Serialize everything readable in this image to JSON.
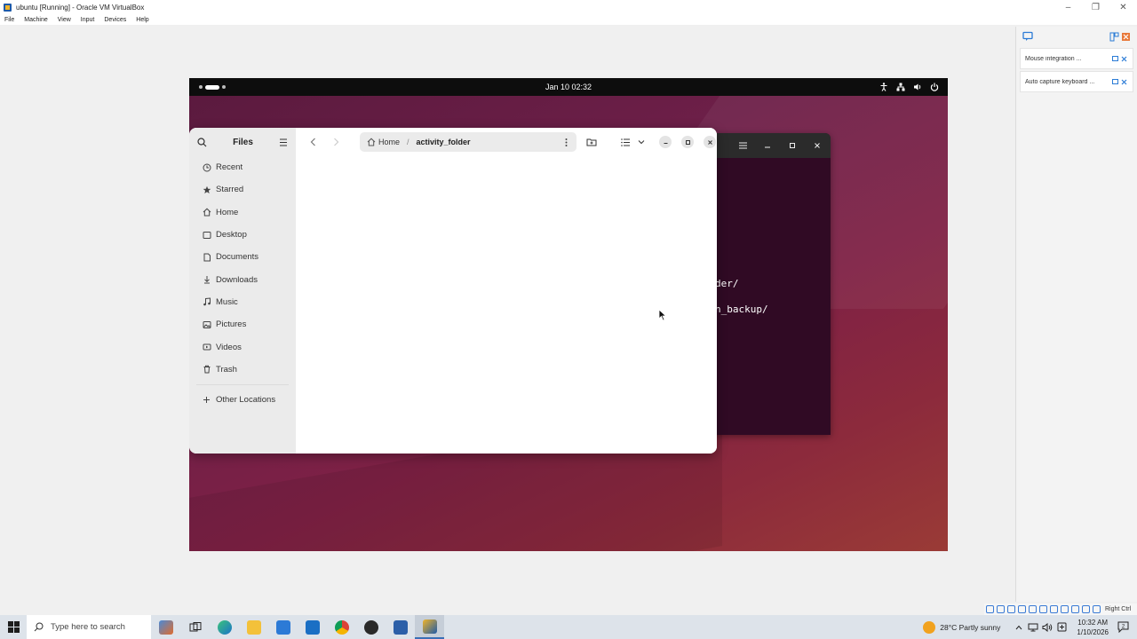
{
  "host_window": {
    "title": "ubuntu [Running] - Oracle VM VirtualBox",
    "menu": [
      "File",
      "Machine",
      "View",
      "Input",
      "Devices",
      "Help"
    ]
  },
  "side_panel": {
    "rows": [
      "Mouse integration ...",
      "Auto capture keyboard ..."
    ]
  },
  "status_bar": {
    "host_key": "Right Ctrl"
  },
  "guest": {
    "topbar": {
      "clock": "Jan 10  02:32"
    },
    "terminal": {
      "lines": [
        "der/",
        "n_backup/"
      ]
    },
    "files": {
      "title": "Files",
      "path": {
        "home": "Home",
        "separator": "/",
        "current": "activity_folder"
      },
      "sidebar": [
        {
          "label": "Recent",
          "icon": "clock-icon"
        },
        {
          "label": "Starred",
          "icon": "star-icon"
        },
        {
          "label": "Home",
          "icon": "home-icon"
        },
        {
          "label": "Desktop",
          "icon": "desktop-icon"
        },
        {
          "label": "Documents",
          "icon": "documents-icon"
        },
        {
          "label": "Downloads",
          "icon": "download-icon"
        },
        {
          "label": "Music",
          "icon": "music-icon"
        },
        {
          "label": "Pictures",
          "icon": "pictures-icon"
        },
        {
          "label": "Videos",
          "icon": "videos-icon"
        },
        {
          "label": "Trash",
          "icon": "trash-icon"
        }
      ],
      "other_locations": "Other Locations"
    }
  },
  "taskbar": {
    "search_placeholder": "Type here to search",
    "weather": "28°C  Partly sunny",
    "time": "10:32 AM",
    "date": "1/10/2026"
  },
  "colors": {
    "gnome_bar": "#0d0d0d",
    "terminal_bg": "#300a24",
    "wallpaper": "#6d1f48",
    "taskbar": "#dde3ea"
  }
}
